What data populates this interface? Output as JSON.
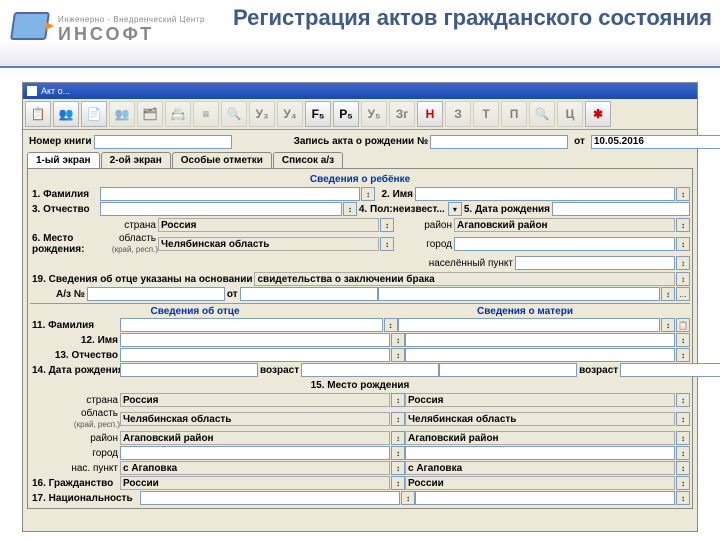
{
  "logo": {
    "small": "Инженерно - Внедренческий Центр",
    "big": "ИНСОФТ"
  },
  "page_title": "Регистрация актов гражданского состояния",
  "window": {
    "title": "Акт о..."
  },
  "toolbar": {
    "b1": "📋",
    "b2": "👥",
    "b3": "📄",
    "b4": "👥",
    "b5": "🗂",
    "b6": "📇",
    "b7": "≡",
    "b8": "🔍",
    "b9": "У₃",
    "b10": "У₄",
    "b11": "F₅",
    "b12": "Р₅",
    "b13": "У₅",
    "b14": "Зг",
    "b15": "Н",
    "b16": "З",
    "b17": "Т",
    "b18": "П",
    "b19": "🔍",
    "b20": "Ц",
    "b21": "✱"
  },
  "top": {
    "book_no_lbl": "Номер книги",
    "act_lbl": "Запись акта о рождении №",
    "from_lbl": "от",
    "from_val": "10.05.2016"
  },
  "tabs": {
    "t1": "1-ый экран",
    "t2": "2-ой экран",
    "t3": "Особые отметки",
    "t4": "Список а/з"
  },
  "child": {
    "hdr": "Сведения о ребёнке",
    "f1": "1. Фамилия",
    "f2": "2. Имя",
    "f3": "3. Отчество",
    "f4": "4. Пол:неизвест...",
    "f5": "5. Дата рождения",
    "f6": "6. Место",
    "f6b": "рождения:",
    "country_lbl": "страна",
    "country": "Россия",
    "region_lbl": "область",
    "region_lbl2": "(край, респ.)",
    "region": "Челябинская область",
    "district_lbl": "район",
    "district": "Агаповский район",
    "city_lbl": "город",
    "settle_lbl": "населённый пункт",
    "f19": "19. Сведения об отце указаны на основании",
    "f19v": "свидетельства о заключении брака",
    "az": "А/з №",
    "ot": "от"
  },
  "parents": {
    "father_hdr": "Сведения об отце",
    "mother_hdr": "Сведения о матери",
    "f11": "11. Фамилия",
    "f12": "12. Имя",
    "f13": "13. Отчество",
    "f14": "14. Дата рождения",
    "age": "возраст",
    "f15": "15. Место рождения",
    "country_lbl": "страна",
    "country": "Россия",
    "region_lbl": "область",
    "region_lbl2": "(край, респ.)",
    "region": "Челябинская область",
    "district_lbl": "район",
    "district": "Агаповский район",
    "city_lbl": "город",
    "settle_lbl": "нас. пункт",
    "settle": "с Агаповка",
    "f16": "16. Гражданство",
    "f16v": "России",
    "f17": "17. Национальность"
  }
}
